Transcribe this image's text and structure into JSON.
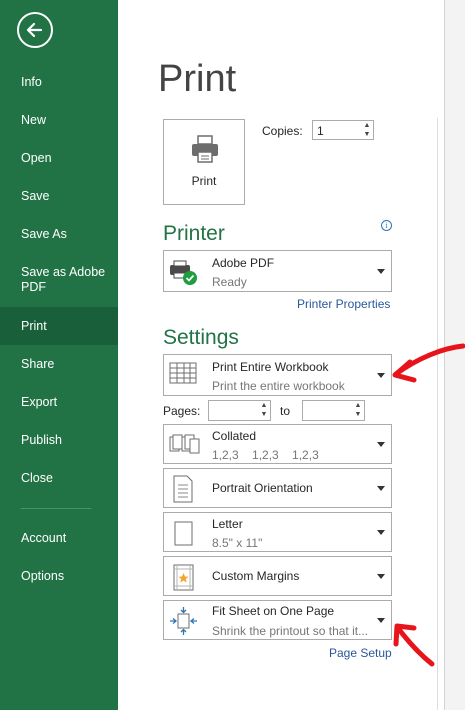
{
  "sidebar": {
    "items": [
      {
        "label": "Info"
      },
      {
        "label": "New"
      },
      {
        "label": "Open"
      },
      {
        "label": "Save"
      },
      {
        "label": "Save As"
      },
      {
        "label": "Save as Adobe PDF"
      },
      {
        "label": "Print"
      },
      {
        "label": "Share"
      },
      {
        "label": "Export"
      },
      {
        "label": "Publish"
      },
      {
        "label": "Close"
      },
      {
        "label": "Account"
      },
      {
        "label": "Options"
      }
    ],
    "active": "Print"
  },
  "main": {
    "title": "Print",
    "print_button_label": "Print",
    "copies_label": "Copies:",
    "copies_value": "1",
    "printer_heading": "Printer",
    "printer": {
      "name": "Adobe PDF",
      "status": "Ready"
    },
    "printer_properties": "Printer Properties",
    "settings_heading": "Settings",
    "settings": {
      "scope": {
        "title": "Print Entire Workbook",
        "subtitle": "Print the entire workbook"
      },
      "pages_label": "Pages:",
      "to_label": "to",
      "pages_from": "",
      "pages_to": "",
      "collation": {
        "title": "Collated",
        "subtitle": "1,2,3    1,2,3    1,2,3"
      },
      "orientation": {
        "title": "Portrait Orientation"
      },
      "paper": {
        "title": "Letter",
        "subtitle": "8.5\" x 11\""
      },
      "margins": {
        "title": "Custom Margins"
      },
      "scaling": {
        "title": "Fit Sheet on One Page",
        "subtitle": "Shrink the printout so that it..."
      }
    },
    "page_setup": "Page Setup"
  },
  "colors": {
    "sidebar": "#217346",
    "sidebar_active": "#19603a",
    "heading": "#217346",
    "link": "#2b579a",
    "annotation": "#e8141b"
  }
}
